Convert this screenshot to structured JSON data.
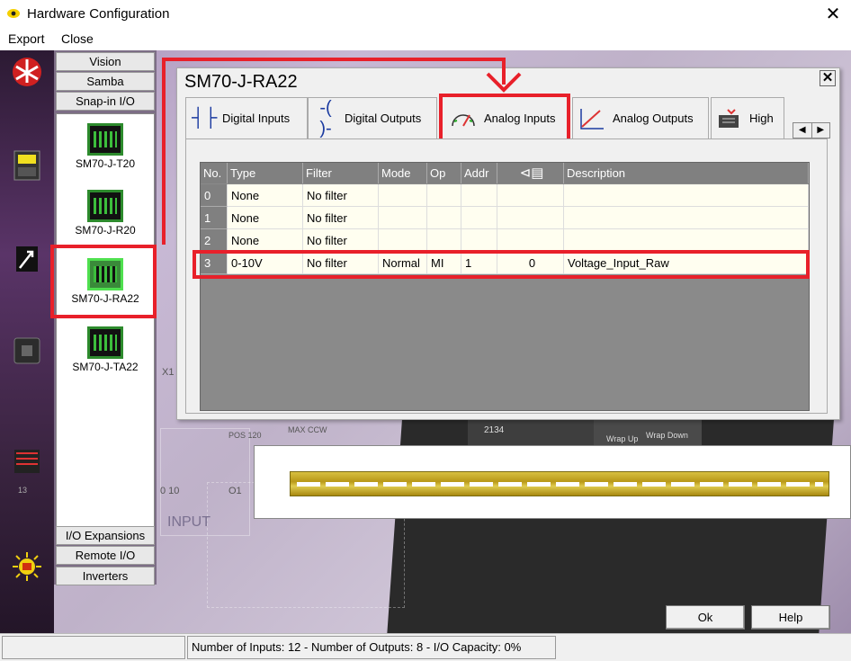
{
  "window": {
    "title": "Hardware Configuration"
  },
  "menu": [
    "Export",
    "Close"
  ],
  "categories": {
    "top": [
      "Vision",
      "Samba",
      "Snap-in I/O"
    ],
    "bottom": [
      "I/O Expansions",
      "Remote I/O",
      "Inverters"
    ]
  },
  "devices": [
    "SM70-J-T20",
    "SM70-J-R20",
    "SM70-J-RA22",
    "SM70-J-TA22"
  ],
  "dialog": {
    "title": "SM70-J-RA22",
    "tabs": [
      {
        "label": "Digital Inputs",
        "icon": "digital-inputs-icon"
      },
      {
        "label": "Digital Outputs",
        "icon": "digital-outputs-icon"
      },
      {
        "label": "Analog Inputs",
        "icon": "analog-inputs-icon"
      },
      {
        "label": "Analog Outputs",
        "icon": "analog-outputs-icon"
      },
      {
        "label": "High",
        "icon": "high-speed-icon"
      }
    ],
    "active_tab": "Analog Inputs",
    "table": {
      "headers": [
        "No.",
        "Type",
        "Filter",
        "Mode",
        "Op",
        "Addr",
        "",
        "Description"
      ],
      "rows": [
        [
          "0",
          "None",
          "No filter",
          "",
          "",
          "",
          "",
          ""
        ],
        [
          "1",
          "None",
          "No filter",
          "",
          "",
          "",
          "",
          ""
        ],
        [
          "2",
          "None",
          "No filter",
          "",
          "",
          "",
          "",
          ""
        ],
        [
          "3",
          "0-10V",
          "No filter",
          "Normal",
          "MI",
          "1",
          "0",
          "Voltage_Input_Raw"
        ]
      ]
    }
  },
  "background_labels": {
    "x1": "X1",
    "max_ccw": "MAX CCW",
    "pos120": "POS 120",
    "v2134": "2134",
    "wrap_up": "Wrap Up",
    "wrap_down": "Wrap Down",
    "io10": "0 10",
    "o1": "O1",
    "input": "INPUT",
    "n13": "13"
  },
  "buttons": {
    "ok": "Ok",
    "help": "Help"
  },
  "status": {
    "text": "Number of Inputs: 12  -  Number of Outputs: 8  -  I/O Capacity: 0%"
  },
  "colors": {
    "highlight": "#e8202a",
    "accent": "#ffd700"
  }
}
